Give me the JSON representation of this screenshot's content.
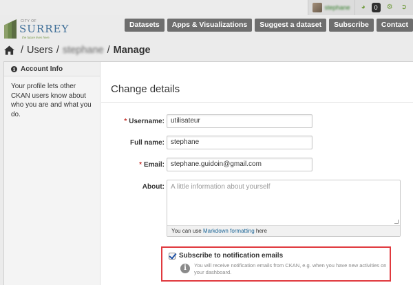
{
  "account": {
    "username": "stephane",
    "activity_count": "0"
  },
  "logo": {
    "small_text": "CITY OF",
    "name": "SURREY",
    "tagline": "the future lives here."
  },
  "nav": {
    "items": [
      {
        "label": "Datasets"
      },
      {
        "label": "Apps & Visualizations"
      },
      {
        "label": "Suggest a dataset"
      },
      {
        "label": "Subscribe"
      },
      {
        "label": "Contact"
      }
    ]
  },
  "breadcrumb": {
    "users": "Users",
    "user": "stephane",
    "current": "Manage"
  },
  "sidebar": {
    "heading": "Account Info",
    "body": "Your profile lets other CKAN users know about who you are and what you do."
  },
  "form": {
    "heading": "Change details",
    "username_label": "Username:",
    "username_value": "utilisateur",
    "fullname_label": "Full name:",
    "fullname_value": "stephane",
    "email_label": "Email:",
    "email_value": "stephane.guidoin@gmail.com",
    "about_label": "About:",
    "about_placeholder": "A little information about yourself",
    "markdown_prefix": "You can use ",
    "markdown_link": "Markdown formatting",
    "markdown_suffix": " here",
    "subscribe_label": "Subscribe to notification emails",
    "subscribe_help": "You will receive notification emails from CKAN, e.g. when you have new activities on your dashboard.",
    "subscribe_checked": true
  },
  "colors": {
    "nav_bg": "#6e6e6e",
    "highlight_border": "#e0393e",
    "link": "#1a6496",
    "required": "#c6342f"
  }
}
